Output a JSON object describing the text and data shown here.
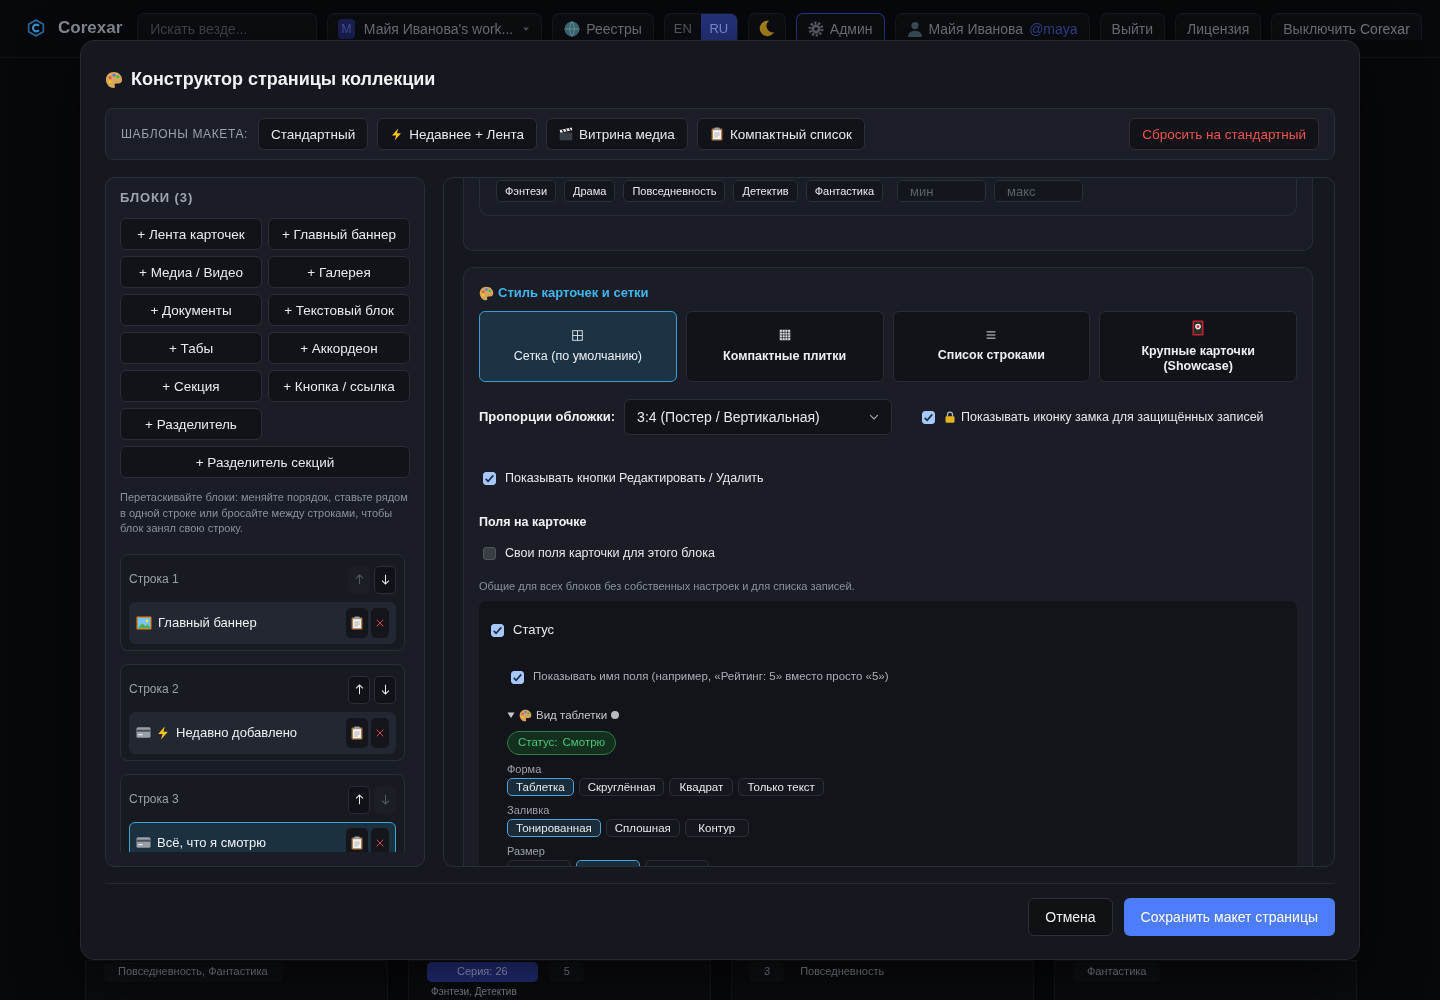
{
  "nav": {
    "logo": "Corexar",
    "search": {
      "placeholder": "Искать везде..."
    },
    "workspace": {
      "badge": "M",
      "label": "Майя Иванова's work..."
    },
    "registries": {
      "label": "Реестры",
      "selected": false
    },
    "languages": [
      {
        "label": "EN",
        "selected": false
      },
      {
        "label": "RU",
        "selected": true
      }
    ],
    "admin": {
      "label": "Админ",
      "selected": true
    },
    "user": {
      "name": "Майя Иванова",
      "handle": "@maya"
    },
    "actions": [
      "Выйти",
      "Лицензия",
      "Выключить Corexar"
    ]
  },
  "background_cards": [
    {
      "lines": [
        [
          {
            "kind": "tag",
            "label": "Повседневность, Фантастика"
          }
        ]
      ]
    },
    {
      "lines": [
        [
          {
            "kind": "series",
            "label": "Серия: 26"
          },
          {
            "kind": "tag",
            "label": "5"
          }
        ],
        [
          {
            "kind": "text",
            "label": "Фэнтези, Детектив"
          }
        ]
      ]
    },
    {
      "lines": [
        [
          {
            "kind": "tag",
            "label": "3"
          },
          {
            "kind": "text",
            "label": "Повседневность"
          }
        ]
      ]
    },
    {
      "lines": [
        [
          {
            "kind": "tag",
            "label": "Фантастика"
          }
        ]
      ]
    }
  ],
  "modal": {
    "title": "Конструктор страницы коллекции",
    "templates": {
      "label": "ШАБЛОНЫ МАКЕТА:",
      "items": [
        {
          "kind": "standard",
          "label": "Стандартный"
        },
        {
          "kind": "recent",
          "label": "Недавнее + Лента"
        },
        {
          "kind": "media",
          "label": "Витрина медиа"
        },
        {
          "kind": "compact",
          "label": "Компактный список"
        }
      ],
      "reset": "Сбросить на стандартный"
    },
    "blocks": {
      "title": "БЛОКИ (3)",
      "add_buttons": [
        "+ Лента карточек",
        "+ Главный баннер",
        "+ Медиа / Видео",
        "+ Галерея",
        "+ Документы",
        "+ Текстовый блок",
        "+ Табы",
        "+ Аккордеон",
        "+ Секция",
        "+ Кнопка / ссылка",
        "+ Разделитель",
        "+ Разделитель секций"
      ],
      "hint": "Перетаскивайте блоки: меняйте порядок, ставьте рядом в одной строке или бросайте между строками, чтобы блок занял свою строку.",
      "rows": [
        {
          "label": "Строка 1",
          "move_up": {
            "disabled": true
          },
          "move_down": {
            "disabled": false
          },
          "items": [
            {
              "kind": "banner",
              "title": "Главный баннер",
              "selected": false
            }
          ]
        },
        {
          "label": "Строка 2",
          "move_up": {
            "disabled": false
          },
          "move_down": {
            "disabled": false
          },
          "items": [
            {
              "kind": "recent",
              "title": "Недавно добавлено",
              "selected": false
            }
          ]
        },
        {
          "label": "Строка 3",
          "move_up": {
            "disabled": false
          },
          "move_down": {
            "disabled": true
          },
          "items": [
            {
              "kind": "feed",
              "title": "Всё, что я смотрю",
              "selected": true
            }
          ]
        }
      ]
    },
    "settings": {
      "filters": {
        "genres": [
          {
            "label": "Фэнтези",
            "selected": false
          },
          {
            "label": "Драма",
            "selected": false
          },
          {
            "label": "Повседневность",
            "selected": false
          },
          {
            "label": "Детектив",
            "selected": false
          },
          {
            "label": "Фантастика",
            "selected": false
          }
        ],
        "min": {
          "placeholder": "мин"
        },
        "max": {
          "placeholder": "макс"
        }
      },
      "card_style": {
        "title": "Стиль карточек и сетки",
        "layouts": [
          {
            "kind": "grid",
            "label": "Сетка (по умолчанию)",
            "selected": true
          },
          {
            "kind": "tiles",
            "label": "Компактные плитки",
            "selected": false
          },
          {
            "kind": "list",
            "label": "Список строками",
            "selected": false
          },
          {
            "kind": "showcase",
            "label": "Крупные карточки (Showcase)",
            "selected": false
          }
        ],
        "cover_ratio": {
          "label": "Пропорции обложки:",
          "value": "3:4 (Постер / Вертикальная)"
        },
        "lock_icon": {
          "label": "Показывать иконку замка для защищённых записей",
          "checked": true
        },
        "edit_buttons": {
          "label": "Показывать кнопки Редактировать / Удалить",
          "checked": true
        },
        "fields_title": "Поля на карточке",
        "custom_fields": {
          "label": "Свои поля карточки для этого блока",
          "checked": false
        },
        "fields_hint": "Общие для всех блоков без собственных настроек и для списка записей.",
        "fields": [
          {
            "label": "Статус",
            "checked": true,
            "show_name": {
              "label": "Показывать имя поля (например, «Рейтинг: 5» вместо просто «5»)",
              "checked": true
            },
            "pill_style": {
              "title": "Вид таблетки",
              "expanded": true,
              "preview": {
                "label": "Статус:",
                "value": "Смотрю"
              },
              "groups": [
                {
                  "label": "Форма",
                  "options": [
                    {
                      "label": "Таблетка",
                      "selected": true
                    },
                    {
                      "label": "Скруглённая",
                      "selected": false
                    },
                    {
                      "label": "Квадрат",
                      "selected": false
                    },
                    {
                      "label": "Только текст",
                      "selected": false
                    }
                  ]
                },
                {
                  "label": "Заливка",
                  "options": [
                    {
                      "label": "Тонированная",
                      "selected": true
                    },
                    {
                      "label": "Сплошная",
                      "selected": false
                    },
                    {
                      "label": "Контур",
                      "selected": false
                    }
                  ]
                },
                {
                  "label": "Размер",
                  "options": [
                    {
                      "selected": false
                    },
                    {
                      "selected": true
                    },
                    {
                      "selected": false
                    }
                  ]
                }
              ]
            }
          }
        ]
      }
    },
    "footer": {
      "cancel": "Отмена",
      "save": "Сохранить макет страницы"
    }
  }
}
